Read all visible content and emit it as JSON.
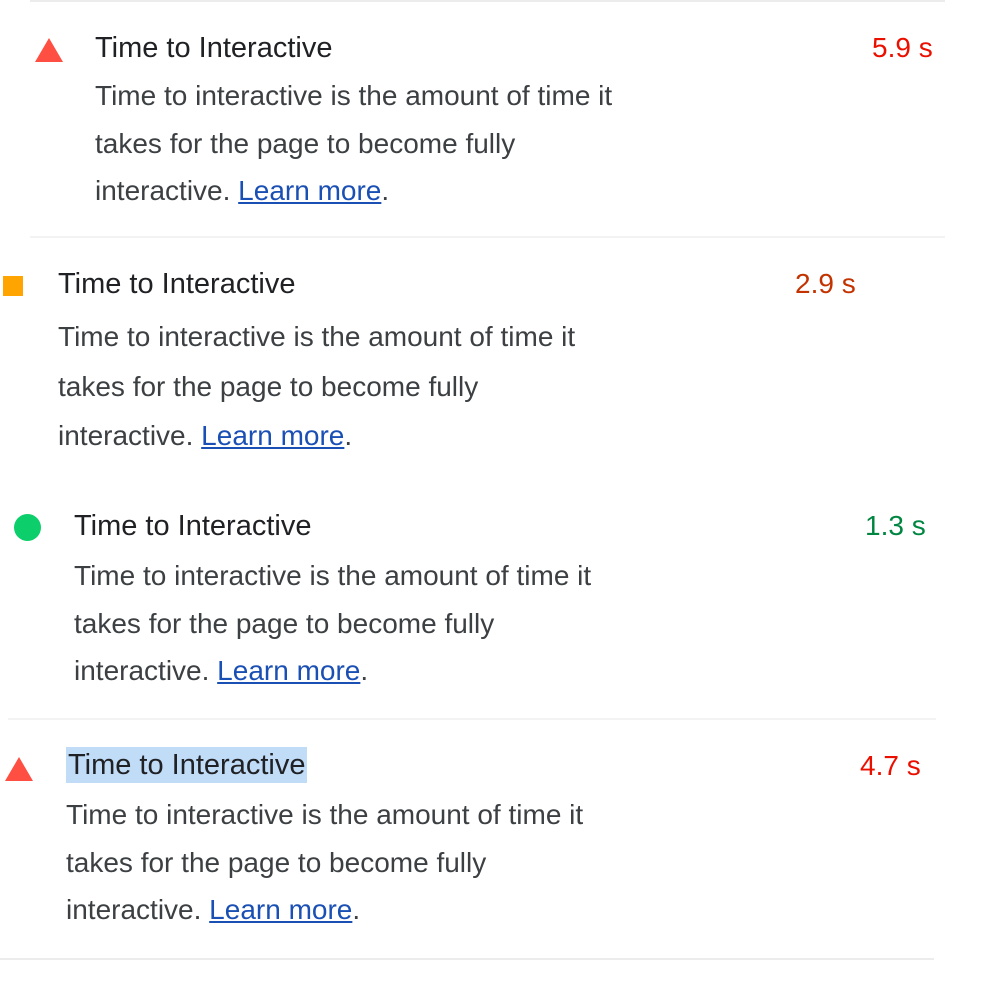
{
  "audits": [
    {
      "status": "fail",
      "title": "Time to Interactive",
      "value": "5.9 s",
      "value_color": "#eb0f00",
      "description_lines": [
        "Time to interactive is the amount of time it",
        "takes for the page to become fully",
        "interactive. "
      ],
      "link_text": "Learn more",
      "trailing": "."
    },
    {
      "status": "average",
      "title": "Time to Interactive",
      "value": "2.9 s",
      "value_color": "#c33300",
      "description_lines": [
        "Time to interactive is the amount of time it",
        "takes for the page to become fully",
        "interactive. "
      ],
      "link_text": "Learn more",
      "trailing": "."
    },
    {
      "status": "pass",
      "title": "Time to Interactive",
      "value": "1.3 s",
      "value_color": "#018642",
      "description_lines": [
        "Time to interactive is the amount of time it",
        "takes for the page to become fully",
        "interactive. "
      ],
      "link_text": "Learn more",
      "trailing": "."
    },
    {
      "status": "fail",
      "title": "Time to Interactive",
      "value": "4.7 s",
      "value_color": "#eb0f00",
      "description_lines": [
        "Time to interactive is the amount of time it",
        "takes for the page to become fully",
        "interactive. "
      ],
      "link_text": "Learn more",
      "trailing": "."
    }
  ],
  "colors": {
    "fail": "#ff4e42",
    "average": "#ffa400",
    "pass": "#0cce6b",
    "link": "#1a4fb4"
  },
  "icons": {
    "fail": "triangle-icon",
    "average": "square-icon",
    "pass": "circle-icon"
  }
}
